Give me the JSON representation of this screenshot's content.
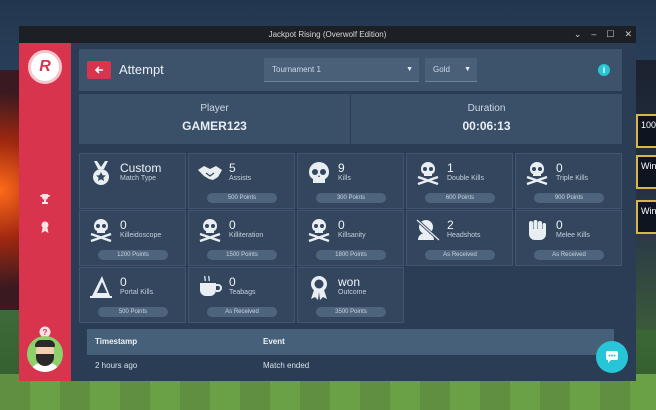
{
  "window": {
    "title": "Jackpot Rising (Overwolf Edition)",
    "controls": [
      "⌄",
      "–",
      "☐",
      "✕"
    ]
  },
  "background_badges": [
    "100",
    "Win",
    "Win"
  ],
  "sidebar": {
    "logo_text": "R",
    "icons": [
      "trophy-icon",
      "medal-icon",
      "help-icon"
    ]
  },
  "header": {
    "title": "Attempt",
    "dropdowns": [
      {
        "value": "Tournament 1"
      },
      {
        "value": "Gold"
      }
    ],
    "info_glyph": "i"
  },
  "summary": [
    {
      "label": "Player",
      "value": "GAMER123"
    },
    {
      "label": "Duration",
      "value": "00:06:13"
    }
  ],
  "tiles": [
    {
      "icon": "medal-icon",
      "value": "Custom",
      "label": "Match Type",
      "points": ""
    },
    {
      "icon": "handshake-icon",
      "value": "5",
      "label": "Assists",
      "points": "500 Points"
    },
    {
      "icon": "skull-icon",
      "value": "9",
      "label": "Kills",
      "points": "300 Points"
    },
    {
      "icon": "skull-crossbones-icon",
      "value": "1",
      "label": "Double Kills",
      "points": "600 Points"
    },
    {
      "icon": "skull-crossbones-icon",
      "value": "0",
      "label": "Triple Kills",
      "points": "900 Points"
    },
    {
      "icon": "skull-crossbones-icon",
      "value": "0",
      "label": "Killeidoscope",
      "points": "1200 Points"
    },
    {
      "icon": "skull-crossbones-icon",
      "value": "0",
      "label": "Killiteration",
      "points": "1500 Points"
    },
    {
      "icon": "skull-crossbones-icon",
      "value": "0",
      "label": "Killsanity",
      "points": "1800 Points"
    },
    {
      "icon": "headshot-icon",
      "value": "2",
      "label": "Headshots",
      "points": "As Received"
    },
    {
      "icon": "fist-icon",
      "value": "0",
      "label": "Melee Kills",
      "points": "As Received"
    },
    {
      "icon": "portal-icon",
      "value": "0",
      "label": "Portal Kills",
      "points": "500 Points"
    },
    {
      "icon": "teacup-icon",
      "value": "0",
      "label": "Teabags",
      "points": "As Received"
    },
    {
      "icon": "award-ribbon-icon",
      "value": "won",
      "label": "Outcome",
      "points": "3500 Points"
    }
  ],
  "events_table": {
    "columns": [
      "Timestamp",
      "Event"
    ],
    "rows": [
      [
        "2 hours ago",
        "Match ended"
      ]
    ]
  },
  "chat_glyph": "💬"
}
